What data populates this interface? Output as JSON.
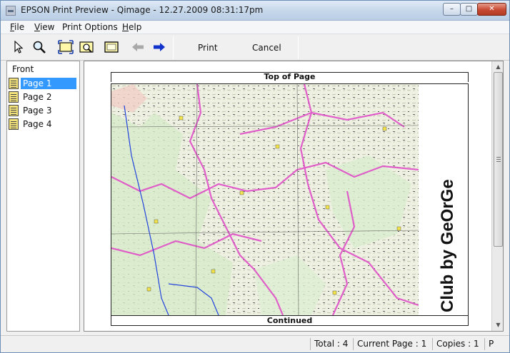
{
  "window": {
    "title": "EPSON Print Preview - Qimage - 12.27.2009 08:31:17pm",
    "controls": {
      "minimize": "–",
      "maximize": "□",
      "close": "✕"
    }
  },
  "menu": {
    "items": [
      {
        "key": "F",
        "rest": "ile"
      },
      {
        "key": "V",
        "rest": "iew"
      },
      {
        "key": "",
        "rest": "Print Options"
      },
      {
        "key": "H",
        "rest": "elp"
      }
    ]
  },
  "toolbar": {
    "icons": [
      "pointer-icon",
      "zoom-icon",
      "fit-width-icon",
      "zoom-page-icon",
      "page-frame-icon",
      "back-arrow-icon",
      "forward-arrow-icon"
    ],
    "print_label": "Print",
    "cancel_label": "Cancel"
  },
  "sidebar": {
    "title": "Front",
    "pages": [
      {
        "label": "Page 1",
        "selected": true
      },
      {
        "label": "Page 2",
        "selected": false
      },
      {
        "label": "Page 3",
        "selected": false
      },
      {
        "label": "Page 4",
        "selected": false
      }
    ]
  },
  "preview": {
    "top_label": "Top of Page",
    "bottom_label": "Continued",
    "watermark": "Club by GeOrGe"
  },
  "status": {
    "total": "Total : 4",
    "current_page": "Current Page : 1",
    "copies": "Copies : 1",
    "extra": "P"
  },
  "colors": {
    "selection": "#3399ff",
    "map_roads": "#e050c8",
    "map_rivers": "#2244dd"
  }
}
